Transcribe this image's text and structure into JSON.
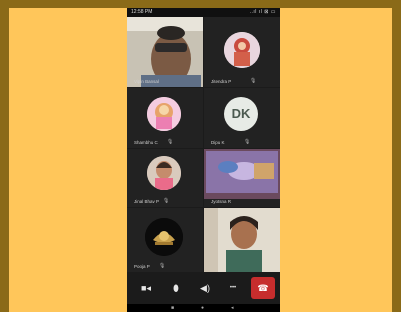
{
  "status_bar": {
    "time": "12:58 PM",
    "icons": "..ıl ıl ⊠ ▭"
  },
  "participants": [
    {
      "name": "Vipin Bansal",
      "mic": ""
    },
    {
      "name": "Jitendra P",
      "mic": "🎙"
    },
    {
      "name": "Shambhu C",
      "mic": "🎙"
    },
    {
      "name": "Dipu K",
      "mic": "🎙",
      "initials": "DK"
    },
    {
      "name": "Jinal Bhav P",
      "mic": "🎙"
    },
    {
      "name": "Jyotsna R",
      "mic": ""
    },
    {
      "name": "Pooja P",
      "mic": "🎙"
    },
    {
      "name": "",
      "mic": ""
    }
  ],
  "controls": {
    "video_icon": "■◂",
    "mic_icon": "⬮",
    "speaker_icon": "◀)",
    "more_icon": "•••",
    "end_call_icon": "☎"
  },
  "navbar": {
    "recent": "■",
    "home": "●",
    "back": "◂"
  },
  "colors": {
    "frame": "#8a6a18",
    "background": "#ffc65a",
    "end_call": "#c62d2d"
  }
}
